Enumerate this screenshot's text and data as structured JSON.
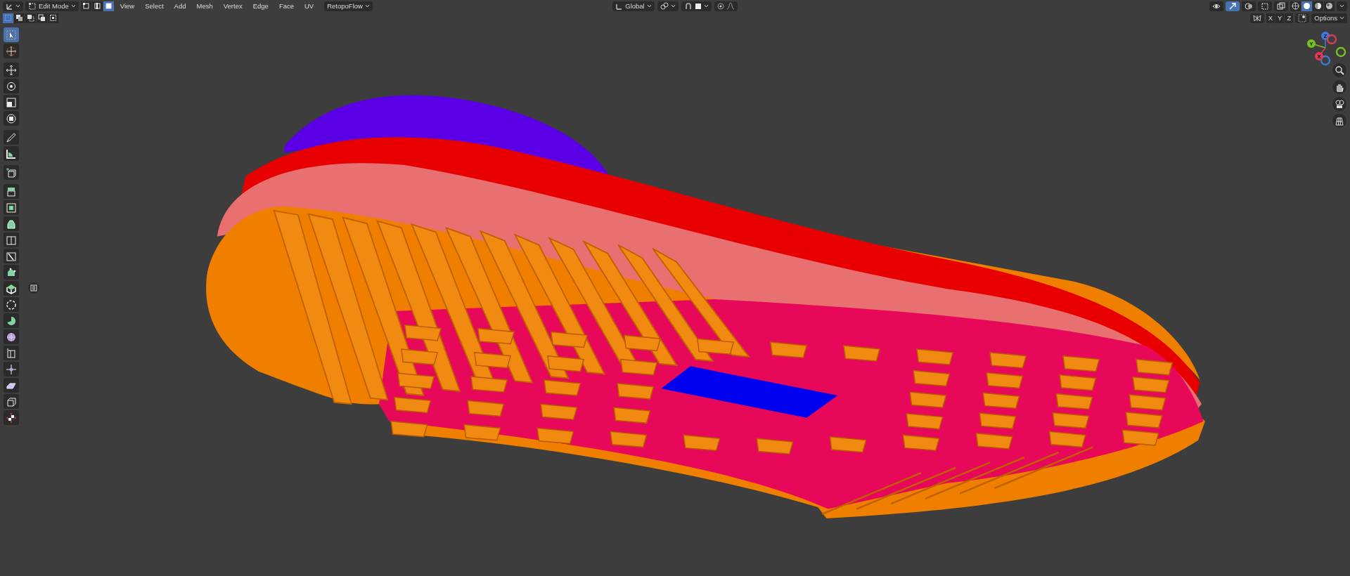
{
  "header": {
    "mode": "Edit Mode",
    "select_modes": [
      {
        "kind": "vertex",
        "selected": false
      },
      {
        "kind": "edge",
        "selected": false
      },
      {
        "kind": "face",
        "selected": true
      }
    ],
    "menus": [
      "View",
      "Select",
      "Add",
      "Mesh",
      "Vertex",
      "Edge",
      "Face",
      "UV"
    ],
    "addon": "RetopoFlow",
    "orientation": "Global",
    "gizmo_toggle": {
      "on": true
    },
    "xray": {
      "on": false
    },
    "shading_modes": [
      {
        "kind": "wireframe",
        "selected": false
      },
      {
        "kind": "solid",
        "selected": true
      },
      {
        "kind": "material",
        "selected": false
      },
      {
        "kind": "rendered",
        "selected": false
      }
    ],
    "mirror_axes": [
      {
        "label": "X",
        "on": false
      },
      {
        "label": "Y",
        "on": false
      },
      {
        "label": "Z",
        "on": false
      }
    ],
    "options": "Options"
  },
  "selection_modes": [
    {
      "kind": "set",
      "selected": true
    },
    {
      "kind": "extend",
      "selected": false
    },
    {
      "kind": "subtract",
      "selected": false
    },
    {
      "kind": "invert",
      "selected": false
    },
    {
      "kind": "intersect",
      "selected": false
    }
  ],
  "toolbar": [
    [
      {
        "kind": "select_box",
        "selected": true
      },
      {
        "kind": "cursor",
        "selected": false
      }
    ],
    [
      {
        "kind": "move",
        "selected": false
      },
      {
        "kind": "rotate",
        "selected": false
      },
      {
        "kind": "scale",
        "selected": false
      },
      {
        "kind": "transform",
        "selected": false
      }
    ],
    [
      {
        "kind": "annotate",
        "selected": false
      },
      {
        "kind": "measure",
        "selected": false
      }
    ],
    [
      {
        "kind": "add_cube",
        "selected": false
      }
    ],
    [
      {
        "kind": "extrude",
        "selected": false
      },
      {
        "kind": "inset",
        "selected": false
      },
      {
        "kind": "bevel",
        "selected": false
      },
      {
        "kind": "loop_cut",
        "selected": false
      },
      {
        "kind": "knife",
        "selected": false
      },
      {
        "kind": "poly_build",
        "selected": false
      },
      {
        "kind": "spin",
        "selected": false
      },
      {
        "kind": "smooth",
        "selected": false
      },
      {
        "kind": "pie",
        "selected": false
      },
      {
        "kind": "sphere",
        "selected": false
      },
      {
        "kind": "edge_slide",
        "selected": false
      },
      {
        "kind": "shrink",
        "selected": false
      },
      {
        "kind": "shear",
        "selected": false
      },
      {
        "kind": "rip",
        "selected": false
      },
      {
        "kind": "checker",
        "selected": false
      }
    ]
  ],
  "axes": [
    {
      "label": "Z",
      "color": "#3d7be0"
    },
    {
      "label": "Y",
      "color": "#7ac31f"
    },
    {
      "label": "X",
      "color": "#dd3c55"
    }
  ]
}
